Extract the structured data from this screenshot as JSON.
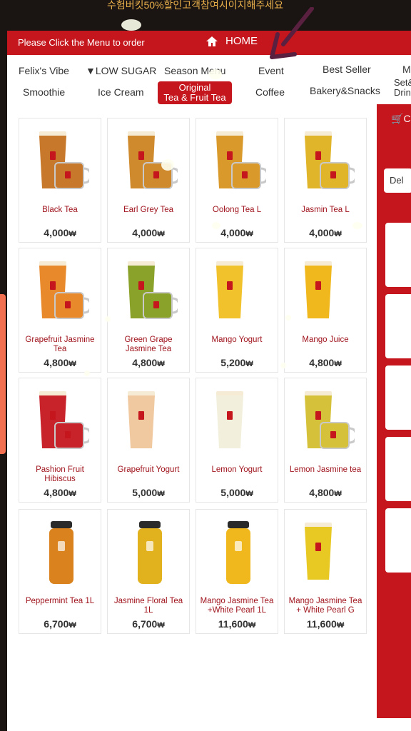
{
  "banner": {
    "text": "수험버킷50%할인고객참여시이지해주세요"
  },
  "header": {
    "instruction": "Please Click the Menu to order",
    "home_label": "HOME"
  },
  "categories": [
    {
      "label": "Felix's Vibe"
    },
    {
      "label": "▼LOW SUGAR"
    },
    {
      "label": "Season Menu"
    },
    {
      "label": "Event"
    },
    {
      "label": "Best Seller"
    },
    {
      "label": "M"
    },
    {
      "label": "Smoothie"
    },
    {
      "label": "Ice Cream"
    },
    {
      "label_line1": "Original",
      "label_line2": "Tea & Fruit Tea"
    },
    {
      "label": "Coffee"
    },
    {
      "label": "Bakery&Snacks"
    },
    {
      "label_line1": "Set&",
      "label_line2": "Drin"
    }
  ],
  "currency": "₩",
  "items": [
    {
      "name": "Black Tea",
      "price": "4,000",
      "type": "cup-mug",
      "color": "#c8782a"
    },
    {
      "name": "Earl Grey Tea",
      "price": "4,000",
      "type": "cup-mug",
      "color": "#d08a2e"
    },
    {
      "name": "Oolong Tea L",
      "price": "4,000",
      "type": "cup-mug",
      "color": "#d99a2b"
    },
    {
      "name": "Jasmin Tea L",
      "price": "4,000",
      "type": "cup-mug",
      "color": "#e1b52a"
    },
    {
      "name": "Grapefruit Jasmine Tea",
      "price": "4,800",
      "type": "cup-mug",
      "color": "#e8892c"
    },
    {
      "name": "Green Grape Jasmine Tea",
      "price": "4,800",
      "type": "cup-mug",
      "color": "#8aa22a"
    },
    {
      "name": "Mango Yogurt",
      "price": "5,200",
      "type": "cup",
      "color": "#f2c22c"
    },
    {
      "name": "Mango Juice",
      "price": "4,800",
      "type": "cup",
      "color": "#f0b81c"
    },
    {
      "name": "Pashion Fruit Hibiscus",
      "price": "4,800",
      "type": "cup-mug",
      "color": "#c8222a"
    },
    {
      "name": "Grapefruit Yogurt",
      "price": "5,000",
      "type": "cup",
      "color": "#f0c9a0"
    },
    {
      "name": "Lemon Yogurt",
      "price": "5,000",
      "type": "cup",
      "color": "#f2f0dc"
    },
    {
      "name": "Lemon Jasmine tea",
      "price": "4,800",
      "type": "cup-mug",
      "color": "#d6c23a"
    },
    {
      "name": "Peppermint Tea 1L",
      "price": "6,700",
      "type": "bottle",
      "color": "#d9821e"
    },
    {
      "name": "Jasmine Floral Tea 1L",
      "price": "6,700",
      "type": "bottle",
      "color": "#e2b21e"
    },
    {
      "name": "Mango Jasmine Tea +White Pearl 1L",
      "price": "11,600",
      "type": "bottle",
      "color": "#f0b81c"
    },
    {
      "name": "Mango Jasmine Tea + White Pearl G",
      "price": "11,600",
      "type": "cup",
      "color": "#e8c822"
    }
  ],
  "side_panel": {
    "cart_label": "C",
    "delete_label": "Del"
  },
  "colors": {
    "brand": "#c4161c",
    "item_name": "#a0151e"
  }
}
